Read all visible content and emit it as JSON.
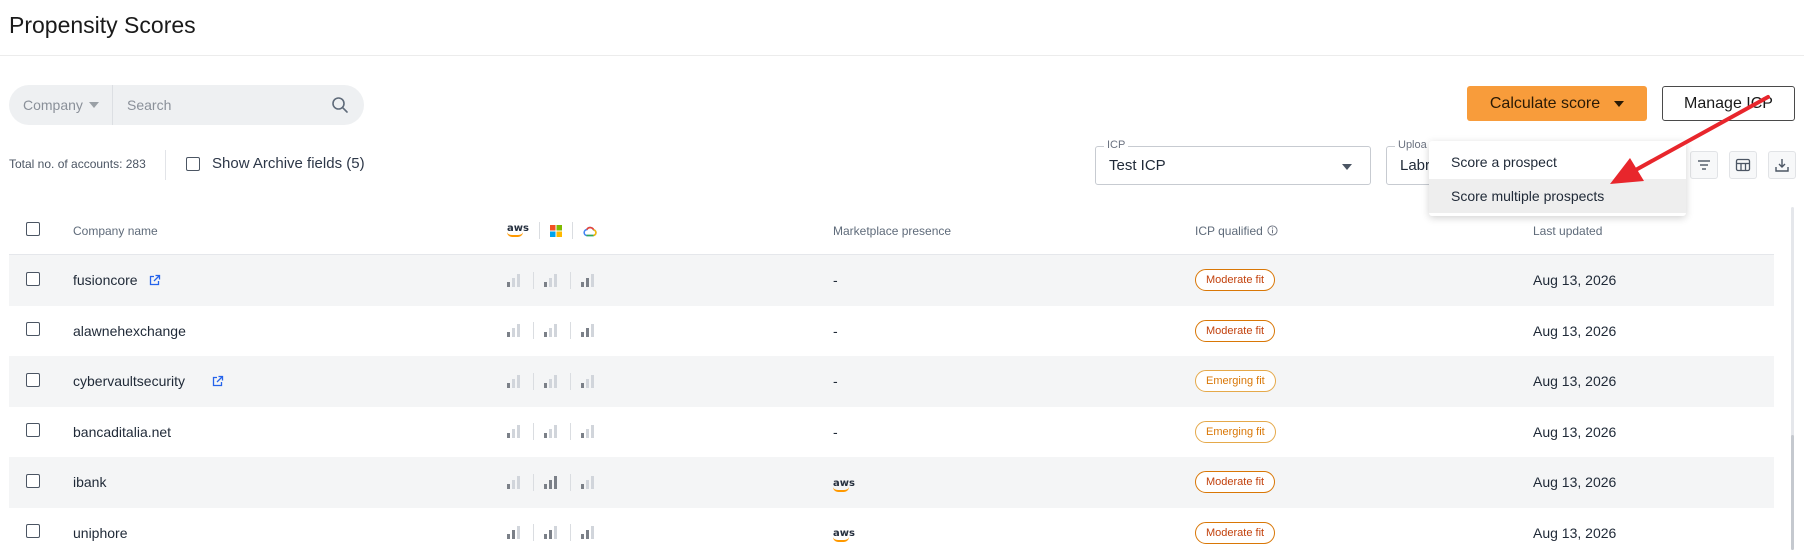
{
  "page": {
    "title": "Propensity Scores"
  },
  "search": {
    "scope": "Company",
    "placeholder": "Search"
  },
  "actions": {
    "calculate_label": "Calculate score",
    "manage_label": "Manage ICP"
  },
  "calc_menu": {
    "items": [
      "Score a prospect",
      "Score multiple prospects"
    ]
  },
  "summary": {
    "total_text": "Total no. of accounts: 283",
    "archive_label": "Show Archive fields (5)"
  },
  "filters": {
    "icp": {
      "label": "ICP",
      "value": "Test ICP"
    },
    "upload": {
      "label": "Uploa",
      "value": "Labre"
    }
  },
  "table": {
    "columns": {
      "company": "Company name",
      "marketplace": "Marketplace presence",
      "icp": "ICP qualified",
      "updated": "Last updated"
    },
    "cloud_icons": [
      "aws-icon",
      "microsoft-icon",
      "google-cloud-icon"
    ],
    "rows": [
      {
        "name": "fusioncore",
        "external": true,
        "signals": [
          1,
          1,
          2
        ],
        "marketplace": "-",
        "marketplace_logo": "",
        "fit": "Moderate fit",
        "fit_type": "moderate",
        "updated": "Aug 13, 2026"
      },
      {
        "name": "alawnehexchange",
        "external": false,
        "signals": [
          1,
          1,
          2
        ],
        "marketplace": "-",
        "marketplace_logo": "",
        "fit": "Moderate fit",
        "fit_type": "moderate",
        "updated": "Aug 13, 2026"
      },
      {
        "name": "cybervaultsecurity",
        "external": true,
        "signals": [
          1,
          1,
          1
        ],
        "marketplace": "-",
        "marketplace_logo": "",
        "fit": "Emerging fit",
        "fit_type": "emerging",
        "updated": "Aug 13, 2026"
      },
      {
        "name": "bancaditalia.net",
        "external": false,
        "signals": [
          1,
          1,
          1
        ],
        "marketplace": "-",
        "marketplace_logo": "",
        "fit": "Emerging fit",
        "fit_type": "emerging",
        "updated": "Aug 13, 2026"
      },
      {
        "name": "ibank",
        "external": false,
        "signals": [
          1,
          3,
          1
        ],
        "marketplace": "",
        "marketplace_logo": "aws",
        "fit": "Moderate fit",
        "fit_type": "moderate",
        "updated": "Aug 13, 2026"
      },
      {
        "name": "uniphore",
        "external": false,
        "signals": [
          2,
          2,
          2
        ],
        "marketplace": "",
        "marketplace_logo": "aws",
        "fit": "Moderate fit",
        "fit_type": "moderate",
        "updated": "Aug 13, 2026"
      }
    ]
  },
  "colors": {
    "accent": "#f89c3b",
    "arrow": "#e8262c",
    "moderate": "#c2410c",
    "emerging": "#d97706"
  }
}
